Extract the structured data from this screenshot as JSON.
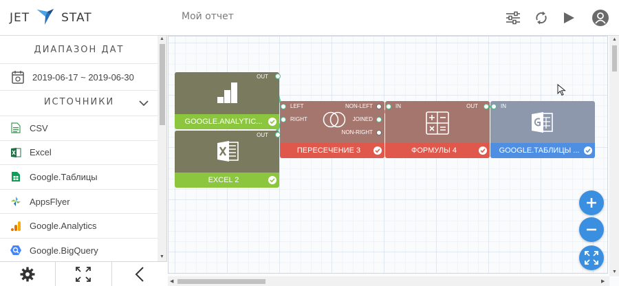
{
  "header": {
    "logo_left": "JET",
    "logo_right": "STAT",
    "report_title": "Мой отчет",
    "icons": [
      "sliders-icon",
      "refresh-icon",
      "play-icon",
      "user-icon"
    ]
  },
  "sidebar": {
    "date_title": "ДИАПАЗОН ДАТ",
    "date_range": "2019-06-17 ~ 2019-06-30",
    "sources_title": "ИСТОЧНИКИ",
    "sources": [
      {
        "label": "CSV",
        "icon": "csv-icon"
      },
      {
        "label": "Excel",
        "icon": "excel-icon"
      },
      {
        "label": "Google.Таблицы",
        "icon": "google-sheets-icon"
      },
      {
        "label": "AppsFlyer",
        "icon": "appsflyer-icon"
      },
      {
        "label": "Google.Analytics",
        "icon": "google-analytics-icon"
      },
      {
        "label": "Google.BigQuery",
        "icon": "google-bigquery-icon"
      }
    ],
    "bottom_icons": [
      "gear-icon",
      "expand-icon",
      "chevron-left-icon"
    ]
  },
  "nodes": {
    "ga": {
      "label": "GOOGLE.ANALYTIC...",
      "out": "OUT"
    },
    "excel": {
      "label": "EXCEL 2",
      "out": "OUT"
    },
    "intersect": {
      "label": "ПЕРЕСЕЧЕНИЕ 3",
      "left": "LEFT",
      "right": "RIGHT",
      "non_left": "NON-LEFT",
      "joined": "JOINED",
      "non_right": "NON-RIGHT"
    },
    "formulas": {
      "label": "ФОРМУЛЫ 4",
      "in": "IN",
      "out": "OUT"
    },
    "sheets": {
      "label": "GOOGLE.ТАБЛИЦЫ ...",
      "in": "IN"
    }
  },
  "colors": {
    "source_body": "#7a7a5e",
    "source_bar": "#8cc63f",
    "transform_body": "#a5766e",
    "transform_bar": "#e0584b",
    "dest_body": "#8e98ac",
    "dest_bar": "#4e8fe3",
    "link": "#5ec48f",
    "fab": "#3b8fe0"
  }
}
